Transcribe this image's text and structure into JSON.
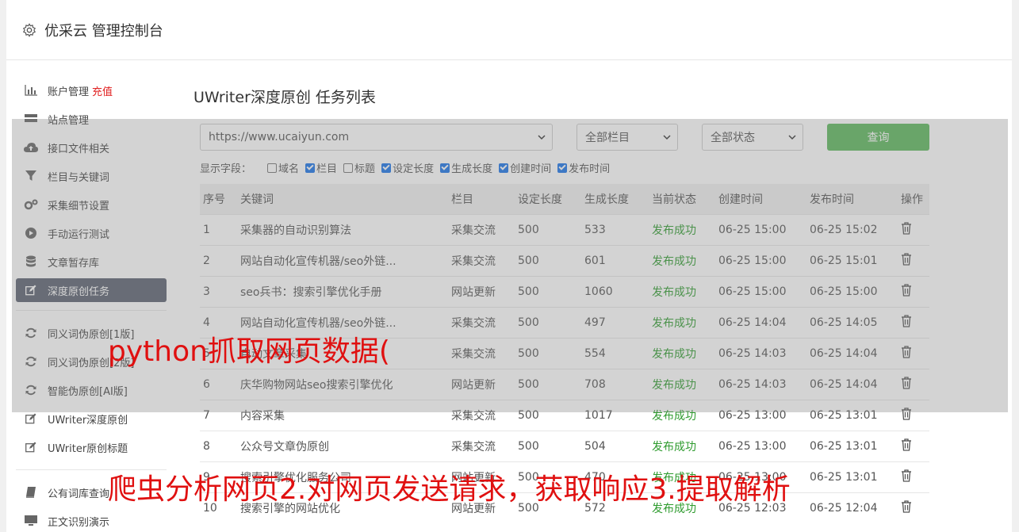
{
  "header": {
    "title": "优采云 管理控制台"
  },
  "sidebar": {
    "items": [
      {
        "label": "账户管理",
        "extra": "充值",
        "icon": "bar-chart-icon"
      },
      {
        "label": "站点管理",
        "icon": "server-icon"
      },
      {
        "label": "接口文件相关",
        "icon": "cloud-upload-icon"
      },
      {
        "label": "栏目与关键词",
        "icon": "filter-icon"
      },
      {
        "label": "采集细节设置",
        "icon": "cogs-icon"
      },
      {
        "label": "手动运行测试",
        "icon": "play-icon"
      },
      {
        "label": "文章暂存库",
        "icon": "database-icon"
      },
      {
        "label": "深度原创任务",
        "icon": "edit-icon"
      },
      {
        "label": "同义词伪原创[1版]",
        "icon": "refresh-icon"
      },
      {
        "label": "同义词伪原创[2版]",
        "icon": "refresh-icon"
      },
      {
        "label": "智能伪原创[AI版]",
        "icon": "refresh-icon"
      },
      {
        "label": "UWriter深度原创",
        "icon": "edit-icon"
      },
      {
        "label": "UWriter原创标题",
        "icon": "edit-icon"
      },
      {
        "label": "公有词库查询",
        "icon": "book-icon"
      },
      {
        "label": "正文识别演示",
        "icon": "monitor-icon"
      }
    ]
  },
  "main": {
    "title": "UWriter深度原创 任务列表",
    "site_select": "https://www.ucaiyun.com",
    "column_select": "全部栏目",
    "status_select": "全部状态",
    "query_label": "查询",
    "fields_label": "显示字段：",
    "fields": [
      {
        "label": "域名",
        "checked": false
      },
      {
        "label": "栏目",
        "checked": true
      },
      {
        "label": "标题",
        "checked": false
      },
      {
        "label": "设定长度",
        "checked": true
      },
      {
        "label": "生成长度",
        "checked": true
      },
      {
        "label": "创建时间",
        "checked": true
      },
      {
        "label": "发布时间",
        "checked": true
      }
    ],
    "table": {
      "headers": [
        "序号",
        "关键词",
        "栏目",
        "设定长度",
        "生成长度",
        "当前状态",
        "创建时间",
        "发布时间",
        "操作"
      ],
      "rows": [
        [
          "1",
          "采集器的自动识别算法",
          "采集交流",
          "500",
          "533",
          "发布成功",
          "06-25 15:00",
          "06-25 15:02"
        ],
        [
          "2",
          "网站自动化宣传机器/seo外链...",
          "采集交流",
          "500",
          "601",
          "发布成功",
          "06-25 15:00",
          "06-25 15:01"
        ],
        [
          "3",
          "seo兵书：搜索引擎优化手册",
          "网站更新",
          "500",
          "1060",
          "发布成功",
          "06-25 15:00",
          "06-25 15:00"
        ],
        [
          "4",
          "网站自动化宣传机器/seo外链...",
          "采集交流",
          "500",
          "497",
          "发布成功",
          "06-25 14:04",
          "06-25 14:05"
        ],
        [
          "5",
          "自动文章采集",
          "采集交流",
          "500",
          "554",
          "发布成功",
          "06-25 14:03",
          "06-25 14:04"
        ],
        [
          "6",
          "庆华购物网站seo搜索引擎优化",
          "网站更新",
          "500",
          "708",
          "发布成功",
          "06-25 14:03",
          "06-25 14:04"
        ],
        [
          "7",
          "内容采集",
          "采集交流",
          "500",
          "1017",
          "发布成功",
          "06-25 13:00",
          "06-25 13:01"
        ],
        [
          "8",
          "公众号文章伪原创",
          "采集交流",
          "500",
          "504",
          "发布成功",
          "06-25 13:00",
          "06-25 13:01"
        ],
        [
          "9",
          "搜索引擎优化服务公司",
          "网站更新",
          "500",
          "470",
          "发布成功",
          "06-25 13:00",
          "06-25 13:01"
        ],
        [
          "10",
          "搜索引擎的网站优化",
          "网站更新",
          "500",
          "572",
          "发布成功",
          "06-25 12:03",
          "06-25 12:04"
        ]
      ]
    }
  },
  "captions": {
    "line1": "python抓取网页数据(",
    "line2": "爬虫分析网页2.对网页发送请求，获取响应3.提取解析",
    "line3": "、"
  }
}
